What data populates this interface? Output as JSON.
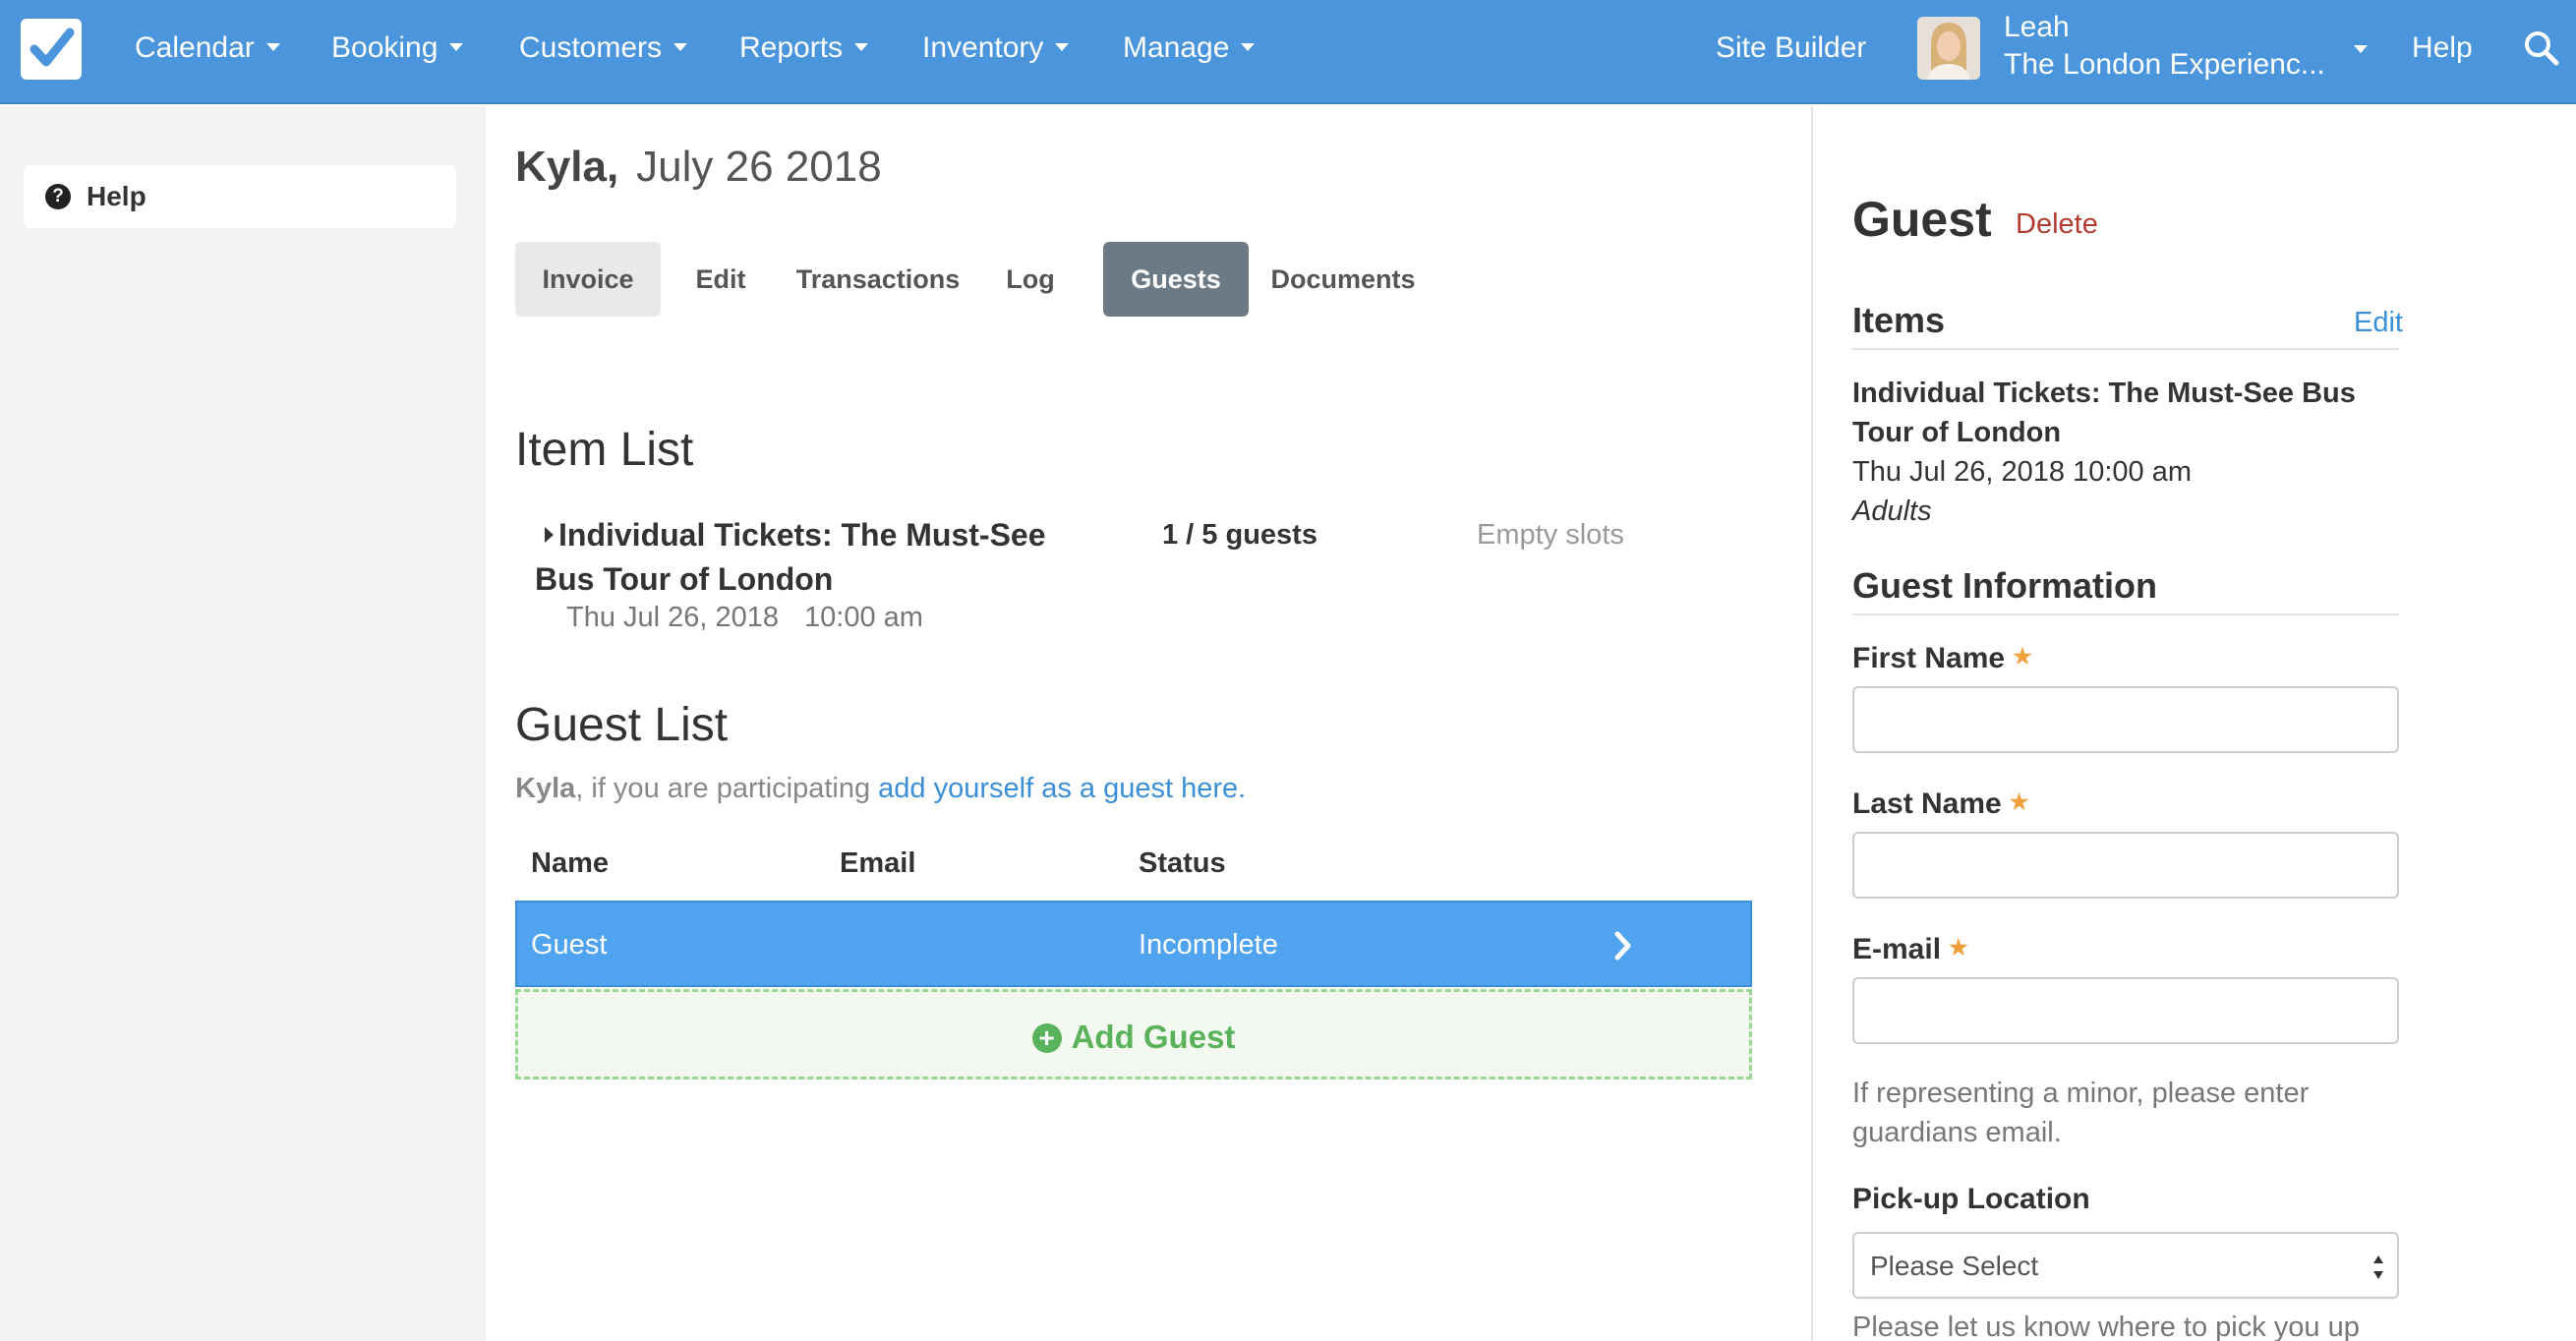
{
  "nav": {
    "items": [
      {
        "label": "Calendar"
      },
      {
        "label": "Booking"
      },
      {
        "label": "Customers"
      },
      {
        "label": "Reports"
      },
      {
        "label": "Inventory"
      },
      {
        "label": "Manage"
      }
    ],
    "site_builder": "Site Builder",
    "user_name": "Leah",
    "user_company": "The London Experienc...",
    "help": "Help"
  },
  "sidebar": {
    "help_label": "Help"
  },
  "booking": {
    "customer": "Kyla,",
    "date": "July 26 2018",
    "tabs": [
      {
        "label": "Invoice"
      },
      {
        "label": "Edit"
      },
      {
        "label": "Transactions"
      },
      {
        "label": "Log"
      },
      {
        "label": "Guests",
        "active": true
      },
      {
        "label": "Documents"
      }
    ]
  },
  "item_list": {
    "title": "Item List",
    "items": [
      {
        "name": "Individual Tickets: The Must-See Bus Tour of London",
        "date": "Thu Jul 26, 2018",
        "time": "10:00 am",
        "count": "1 / 5 guests",
        "slots": "Empty slots"
      }
    ]
  },
  "guest_list": {
    "title": "Guest List",
    "participate_name": "Kyla",
    "participate_text": ", if you are participating ",
    "participate_link": "add yourself as a guest here.",
    "headers": {
      "name": "Name",
      "email": "Email",
      "status": "Status"
    },
    "rows": [
      {
        "name": "Guest",
        "email": "",
        "status": "Incomplete"
      }
    ],
    "add_label": "Add Guest"
  },
  "panel": {
    "title": "Guest",
    "delete": "Delete",
    "items_heading": "Items",
    "edit": "Edit",
    "item_name": "Individual Tickets: The Must-See Bus Tour of London",
    "item_datetime": "Thu Jul 26, 2018 10:00 am",
    "item_type": "Adults",
    "info_heading": "Guest Information",
    "first_name_label": "First Name",
    "last_name_label": "Last Name",
    "email_label": "E-mail",
    "email_help": "If representing a minor, please enter guardians email.",
    "pickup_label": "Pick-up Location",
    "pickup_value": "Please Select",
    "pickup_help": "Please let us know where to pick you up"
  },
  "colors": {
    "nav_bg": "#4a95db",
    "active_tab": "#6c7a86",
    "selected_row": "#4fa3ef",
    "add_green": "#5ab35b",
    "delete_red": "#b03b2e",
    "link_blue": "#3a8fd6",
    "required_orange": "#f0a03a"
  },
  "icons": {
    "logo": "checkbox-logo-icon",
    "search": "search-icon",
    "help": "question-circle-icon",
    "row_chevron": "chevron-right-icon",
    "add": "plus-circle-icon"
  }
}
